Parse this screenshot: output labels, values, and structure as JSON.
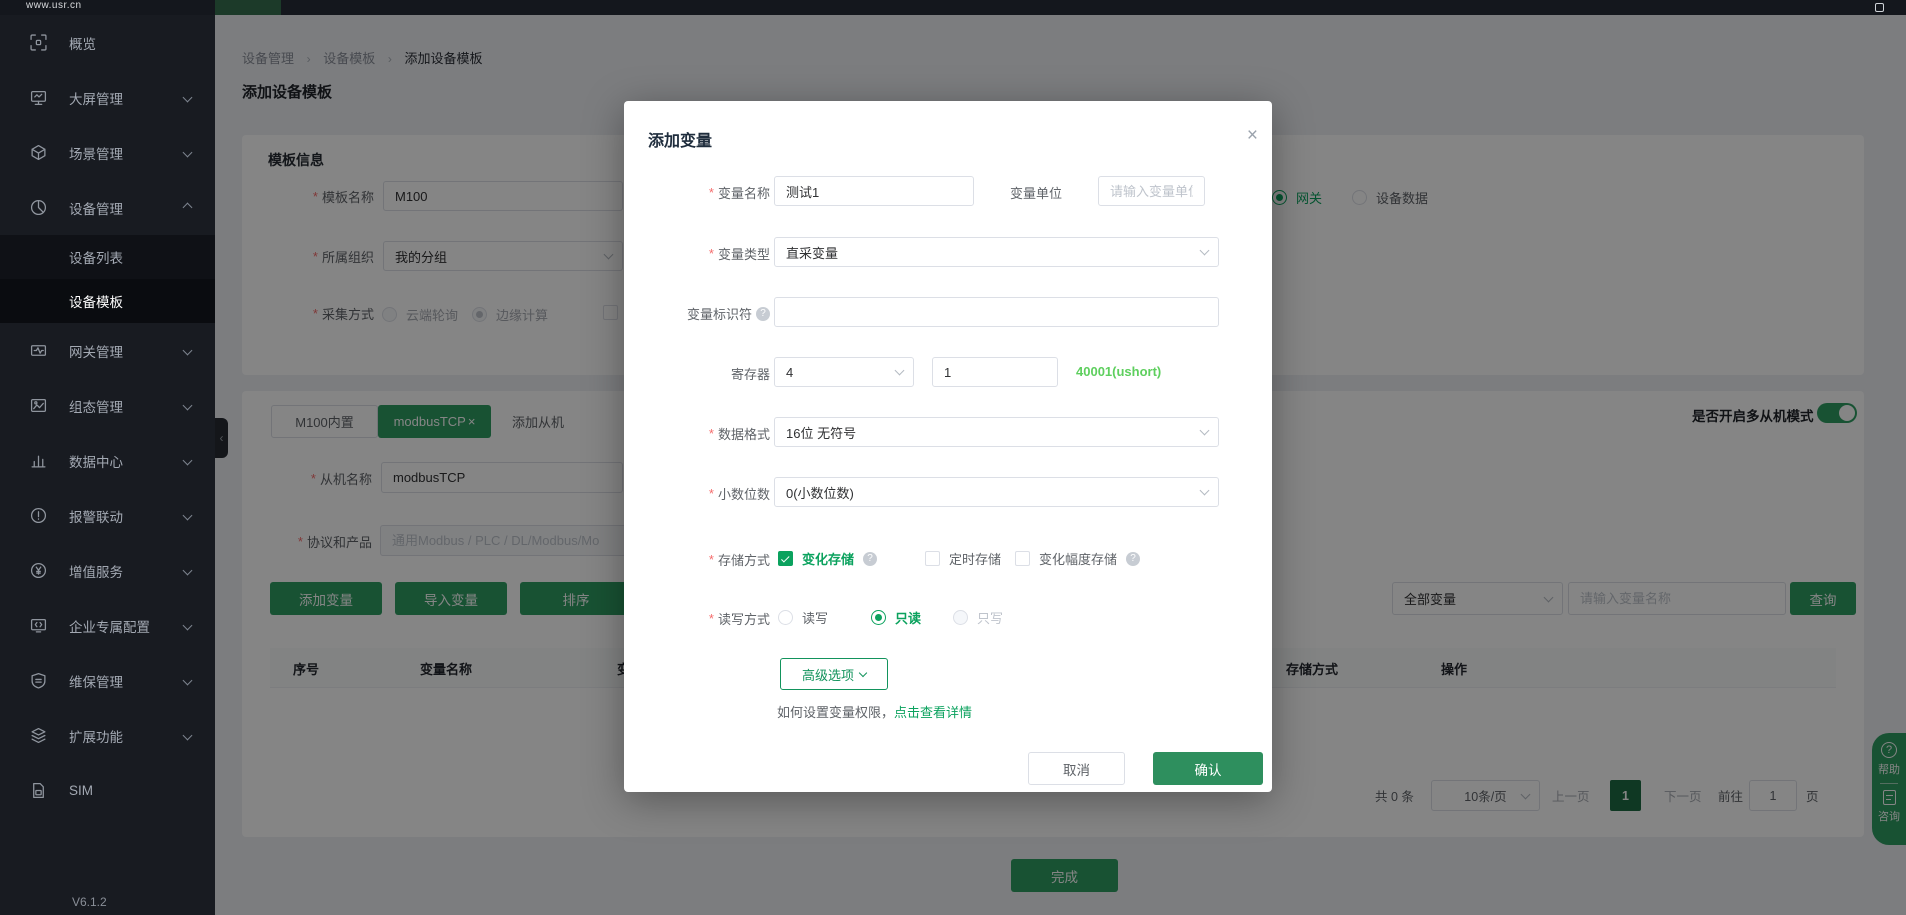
{
  "ui": {
    "required_mark": "*",
    "breadcrumb_separator": "›",
    "close_glyph": "×",
    "help_glyph": "?",
    "collapse_glyph": "‹"
  },
  "colors": {
    "accent_green": "#0ba25e",
    "button_green": "#2f9e63",
    "confirm_green": "#2e8f5e",
    "register_hint_green": "#5ecf5e",
    "sidebar_bg": "#181b21",
    "active_page_green": "#1d6b43"
  },
  "topbar": {
    "logo": "www.usr.cn"
  },
  "sidebar": {
    "version": "V6.1.2",
    "items": [
      {
        "label": "概览"
      },
      {
        "label": "大屏管理"
      },
      {
        "label": "场景管理"
      },
      {
        "label": "设备管理"
      },
      {
        "label": "设备列表"
      },
      {
        "label": "设备模板"
      },
      {
        "label": "网关管理"
      },
      {
        "label": "组态管理"
      },
      {
        "label": "数据中心"
      },
      {
        "label": "报警联动"
      },
      {
        "label": "增值服务"
      },
      {
        "label": "企业专属配置"
      },
      {
        "label": "维保管理"
      },
      {
        "label": "扩展功能"
      },
      {
        "label": "SIM"
      }
    ]
  },
  "breadcrumb": {
    "items": [
      {
        "label": "设备管理"
      },
      {
        "label": "设备模板"
      },
      {
        "label": "添加设备模板"
      }
    ]
  },
  "page": {
    "title": "添加设备模板"
  },
  "template_card": {
    "section_title": "模板信息",
    "name_label": "模板名称",
    "name_value": "M100",
    "org_label": "所属组织",
    "org_value": "我的分组",
    "collect_label": "采集方式",
    "collect_options": [
      {
        "label": "云端轮询"
      },
      {
        "label": "边缘计算"
      }
    ],
    "source_options": [
      {
        "label": "网关"
      },
      {
        "label": "设备数据"
      }
    ]
  },
  "slave_card": {
    "tabs": [
      {
        "label": "M100内置"
      },
      {
        "label": "modbusTCP"
      },
      {
        "label": "添加从机"
      }
    ],
    "multi_slave_label": "是否开启多从机模式",
    "slave_name_label": "从机名称",
    "slave_name_value": "modbusTCP",
    "protocol_label": "协议和产品",
    "protocol_placeholder": "通用Modbus / PLC / DL/Modbus/Mo",
    "add_var_label": "添加变量",
    "import_var_label": "导入变量",
    "sort_label": "排序",
    "filter_value": "全部变量",
    "search_placeholder": "请输入变量名称",
    "query_label": "查询",
    "table_headers": [
      {
        "label": "序号"
      },
      {
        "label": "变量名称"
      },
      {
        "label": "变量标识符"
      },
      {
        "label": "存储方式"
      },
      {
        "label": "操作"
      }
    ],
    "pagination": {
      "total": "共 0 条",
      "page_size": "10条/页",
      "prev": "上一页",
      "page": "1",
      "next": "下一页",
      "goto_label": "前往",
      "goto_value": "1",
      "page_unit": "页"
    }
  },
  "footer": {
    "done_label": "完成"
  },
  "float_widget": {
    "help_label": "帮助",
    "consult_label": "咨询"
  },
  "modal": {
    "title": "添加变量",
    "name_label": "变量名称",
    "name_value": "测试1",
    "unit_label": "变量单位",
    "unit_placeholder": "请输入变量单位",
    "type_label": "变量类型",
    "type_value": "直采变量",
    "identifier_label": "变量标识符",
    "identifier_value": "",
    "register_label": "寄存器",
    "register_select_value": "4",
    "register_addr_value": "1",
    "register_hint": "40001(ushort)",
    "format_label": "数据格式",
    "format_value": "16位 无符号",
    "decimal_label": "小数位数",
    "decimal_value": "0(小数位数)",
    "storage_label": "存储方式",
    "storage_options": [
      {
        "label": "变化存储"
      },
      {
        "label": "定时存储"
      },
      {
        "label": "变化幅度存储"
      }
    ],
    "rw_label": "读写方式",
    "rw_options": [
      {
        "label": "读写"
      },
      {
        "label": "只读"
      },
      {
        "label": "只写"
      }
    ],
    "advanced_label": "高级选项",
    "permission_hint": "如何设置变量权限，",
    "permission_link": "点击查看详情",
    "cancel_label": "取消",
    "confirm_label": "确认"
  }
}
